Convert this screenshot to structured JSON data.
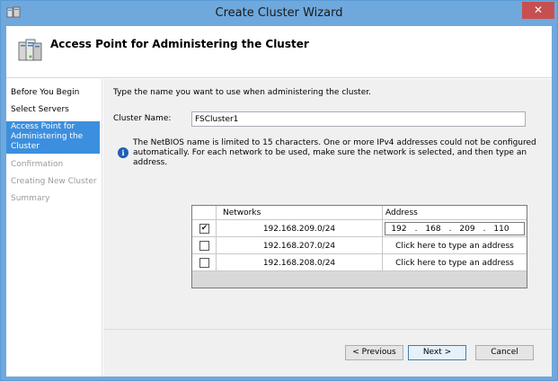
{
  "window": {
    "title": "Create Cluster Wizard",
    "close_glyph": "✕"
  },
  "header": {
    "title": "Access Point for Administering the Cluster",
    "icon": "cluster-servers-icon"
  },
  "nav": {
    "items": [
      {
        "label": "Before You Begin",
        "state": "normal"
      },
      {
        "label": "Select Servers",
        "state": "normal"
      },
      {
        "label": "Access Point for Administering the Cluster",
        "state": "active"
      },
      {
        "label": "Confirmation",
        "state": "disabled"
      },
      {
        "label": "Creating New Cluster",
        "state": "disabled"
      },
      {
        "label": "Summary",
        "state": "disabled"
      }
    ]
  },
  "content": {
    "instruction": "Type the name you want to use when administering the cluster.",
    "cluster_name_label": "Cluster Name:",
    "cluster_name_value": "FSCluster1",
    "info_glyph": "i",
    "info_text": "The NetBIOS name is limited to 15 characters.  One or more IPv4 addresses could not be configured automatically.  For each network to be used, make sure the network is selected, and then type an address."
  },
  "grid": {
    "columns": {
      "networks": "Networks",
      "address": "Address"
    },
    "rows": [
      {
        "checked": true,
        "checkmark": "✔",
        "network": "192.168.209.0/24",
        "address": [
          "192",
          "168",
          "209",
          "110"
        ]
      },
      {
        "checked": false,
        "checkmark": "",
        "network": "192.168.207.0/24",
        "address_placeholder": "Click here to type an address"
      },
      {
        "checked": false,
        "checkmark": "",
        "network": "192.168.208.0/24",
        "address_placeholder": "Click here to type an address"
      }
    ]
  },
  "footer": {
    "previous": "< Previous",
    "next": "Next >",
    "cancel": "Cancel"
  },
  "colors": {
    "titlebar": "#6fa8dc",
    "active_nav": "#3c8fde",
    "close": "#c74f50",
    "content_bg": "#f0f0f0"
  }
}
